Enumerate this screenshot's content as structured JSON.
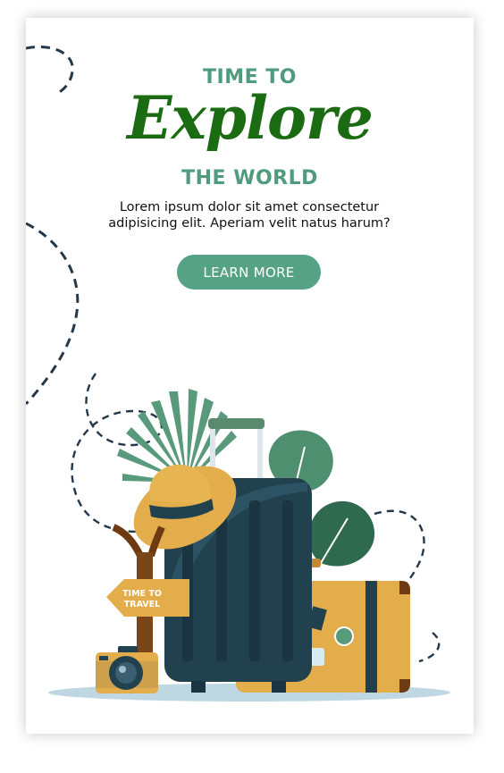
{
  "hero": {
    "kicker_top": "TIME TO",
    "headline": "Explore",
    "kicker_bottom": "THE WORLD",
    "description": "Lorem ipsum dolor sit amet consectetur adipisicing elit. Aperiam velit natus harum?",
    "cta_label": "LEARN MORE"
  },
  "illustration": {
    "signpost_line1": "TIME TO",
    "signpost_line2": "TRAVEL"
  },
  "colors": {
    "heading_green": "#4e9c7d",
    "script_green": "#1a6b12",
    "button_green": "#56a285",
    "suitcase_navy": "#22414f",
    "suitcase_mustard": "#e4ad4c",
    "path_dash": "#25384a"
  }
}
